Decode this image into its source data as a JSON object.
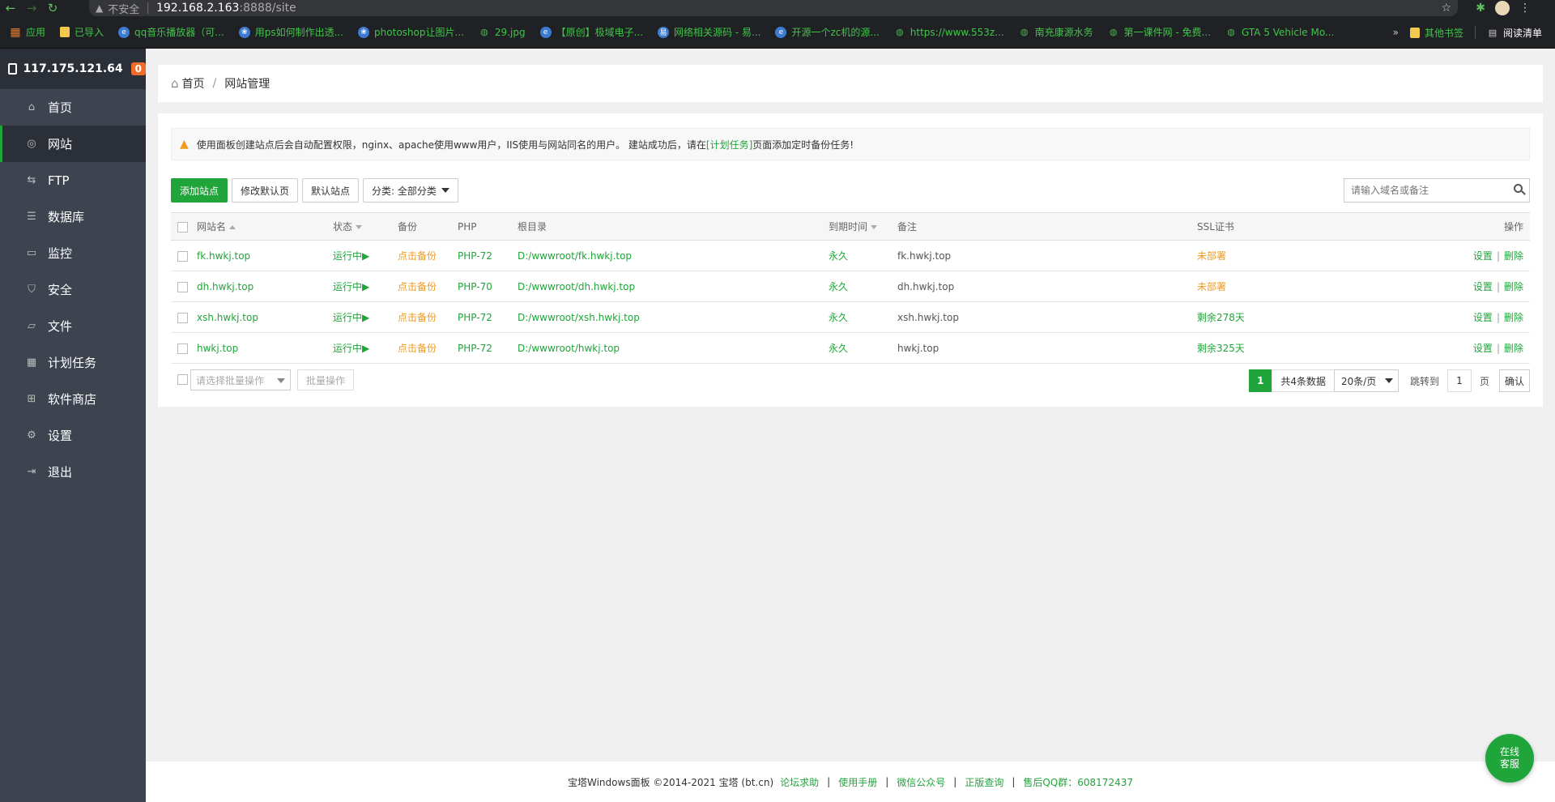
{
  "browser": {
    "insecure_label": "不安全",
    "url_host": "192.168.2.163",
    "url_path": ":8888/site",
    "bookmarks": [
      "应用",
      "已导入",
      "qq音乐播放器（可...",
      "用ps如何制作出透...",
      "photoshop让图片...",
      "29.jpg",
      "【原创】极域电子...",
      "网络相关源码 - 易...",
      "开源一个zc机的源...",
      "https://www.553z...",
      "南充康源水务",
      "第一课件网 - 免费...",
      "GTA 5 Vehicle Mo..."
    ],
    "more_label": "»",
    "other_bookmarks": "其他书签",
    "reading_list": "阅读清单"
  },
  "sidebar": {
    "server_ip": "117.175.121.64",
    "badge": "0",
    "items": [
      {
        "label": "首页",
        "icon": "home-icon"
      },
      {
        "label": "网站",
        "icon": "globe-icon"
      },
      {
        "label": "FTP",
        "icon": "ftp-icon"
      },
      {
        "label": "数据库",
        "icon": "database-icon"
      },
      {
        "label": "监控",
        "icon": "monitor-icon"
      },
      {
        "label": "安全",
        "icon": "shield-icon"
      },
      {
        "label": "文件",
        "icon": "folder-icon"
      },
      {
        "label": "计划任务",
        "icon": "calendar-icon"
      },
      {
        "label": "软件商店",
        "icon": "apps-icon"
      },
      {
        "label": "设置",
        "icon": "gear-icon"
      },
      {
        "label": "退出",
        "icon": "logout-icon"
      }
    ],
    "active": "网站"
  },
  "breadcrumb": {
    "home": "首页",
    "current": "网站管理"
  },
  "tip": {
    "text_before": "使用面板创建站点后会自动配置权限，nginx、apache使用www用户，IIS使用与网站同名的用户。 建站成功后，请在",
    "link": "[计划任务]",
    "text_after": "页面添加定时备份任务!"
  },
  "toolbar": {
    "add_site": "添加站点",
    "modify_default": "修改默认页",
    "default_site": "默认站点",
    "category": "分类: 全部分类",
    "search_placeholder": "请输入域名或备注"
  },
  "table": {
    "headers": {
      "name": "网站名",
      "status": "状态",
      "backup": "备份",
      "php": "PHP",
      "root": "根目录",
      "expire": "到期时间",
      "remark": "备注",
      "ssl": "SSL证书",
      "ops": "操作"
    },
    "rows": [
      {
        "name": "fk.hwkj.top",
        "status": "运行中▶",
        "backup": "点击备份",
        "php": "PHP-72",
        "root": "D:/wwwroot/fk.hwkj.top",
        "expire": "永久",
        "remark": "fk.hwkj.top",
        "ssl": "未部署",
        "set": "设置",
        "del": "删除"
      },
      {
        "name": "dh.hwkj.top",
        "status": "运行中▶",
        "backup": "点击备份",
        "php": "PHP-70",
        "root": "D:/wwwroot/dh.hwkj.top",
        "expire": "永久",
        "remark": "dh.hwkj.top",
        "ssl": "未部署",
        "set": "设置",
        "del": "删除"
      },
      {
        "name": "xsh.hwkj.top",
        "status": "运行中▶",
        "backup": "点击备份",
        "php": "PHP-72",
        "root": "D:/wwwroot/xsh.hwkj.top",
        "expire": "永久",
        "remark": "xsh.hwkj.top",
        "ssl": "剩余278天",
        "set": "设置",
        "del": "删除"
      },
      {
        "name": "hwkj.top",
        "status": "运行中▶",
        "backup": "点击备份",
        "php": "PHP-72",
        "root": "D:/wwwroot/hwkj.top",
        "expire": "永久",
        "remark": "hwkj.top",
        "ssl": "剩余325天",
        "set": "设置",
        "del": "删除"
      }
    ]
  },
  "batch": {
    "select_placeholder": "请选择批量操作",
    "button": "批量操作"
  },
  "pager": {
    "current": "1",
    "total": "共4条数据",
    "page_size": "20条/页",
    "jump": "跳转到",
    "page_value": "1",
    "unit": "页",
    "confirm": "确认"
  },
  "footer": {
    "copyright": "宝塔Windows面板 ©2014-2021 宝塔 (bt.cn)",
    "links": [
      "论坛求助",
      "使用手册",
      "微信公众号",
      "正版查询",
      "售后QQ群：608172437"
    ]
  },
  "chat": {
    "line1": "在线",
    "line2": "客服"
  },
  "colors": {
    "accent": "#20a53a",
    "warning": "#f19a1d",
    "sidebar": "#3d4450"
  }
}
